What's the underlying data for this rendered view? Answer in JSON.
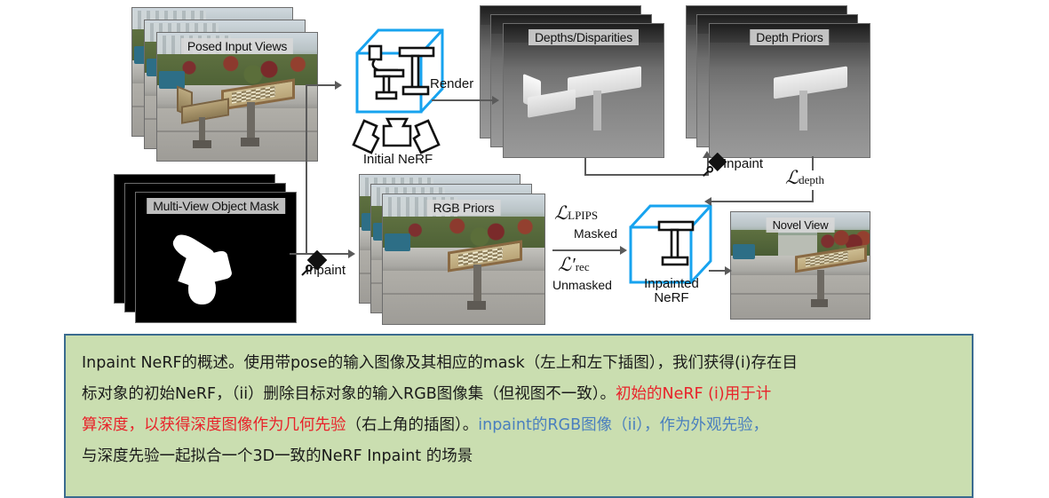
{
  "figure": {
    "panels": {
      "posed_input_views": "Posed Input Views",
      "multi_view_object_mask": "Multi-View Object Mask",
      "depths_disparities": "Depths/Disparities",
      "depth_priors": "Depth Priors",
      "rgb_priors": "RGB Priors",
      "novel_view": "Novel View"
    },
    "nodes": {
      "initial_nerf": "Initial NeRF",
      "inpainted_nerf_line1": "Inpainted",
      "inpainted_nerf_line2": "NeRF"
    },
    "edges": {
      "render": "Render",
      "inpaint_top": "Inpaint",
      "inpaint_left": "Inpaint"
    },
    "losses": {
      "depth": {
        "symbol": "ℒ",
        "subscript": "depth"
      },
      "lpips": {
        "symbol": "ℒ",
        "subscript": "LPIPS",
        "note": "Masked"
      },
      "rec": {
        "symbol": "ℒ′",
        "subscript": "rec",
        "note": "Unmasked"
      }
    },
    "icons": {
      "paintbrush": "paintbrush-icon",
      "camera": "camera-icon"
    },
    "colors": {
      "cube_accent": "#17a3ef",
      "arrow": "#5a5a5a",
      "chip_bg": "#d8d8d8"
    }
  },
  "caption": {
    "line1_black_a": "Inpaint NeRF的概述。使用带pose的输入图像及其相应的mask（左上和左下插图），我们获得(i)存在目",
    "line2_black": "标对象的初始NeRF，（ii）删除目标对象的输入RGB图像集（但视图不一致）。",
    "line2_red": "初始的NeRF (i)用于计",
    "line3_red": "算深度，以获得深度图像作为几何先验",
    "line3_black": "（右上角的插图）。",
    "line3_blue": "inpaint的RGB图像（ii），作为外观先验，",
    "line4_black": "与深度先验一起拟合一个3D一致的NeRF Inpaint 的场景",
    "colors": {
      "red": "#e8232a",
      "blue": "#4a7fbe",
      "background": "#cadeb0",
      "border": "#3a6b8f"
    }
  }
}
